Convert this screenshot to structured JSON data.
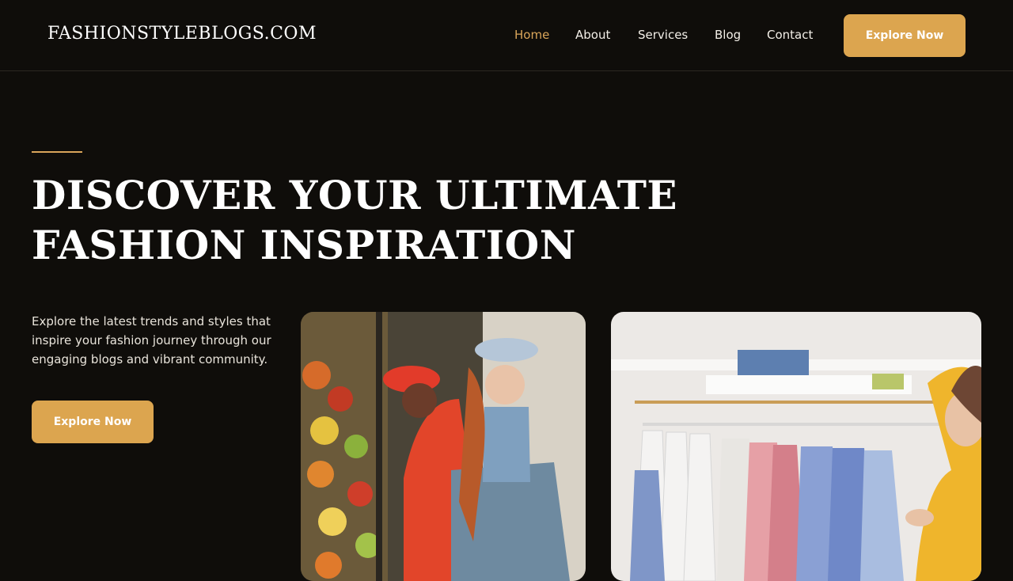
{
  "header": {
    "logo": "FASHIONSTYLEBLOGS.COM",
    "nav": [
      {
        "label": "Home",
        "active": true
      },
      {
        "label": "About",
        "active": false
      },
      {
        "label": "Services",
        "active": false
      },
      {
        "label": "Blog",
        "active": false
      },
      {
        "label": "Contact",
        "active": false
      }
    ],
    "cta_label": "Explore Now"
  },
  "hero": {
    "title": "DISCOVER YOUR ULTIMATE FASHION INSPIRATION",
    "description": "Explore the latest trends and styles that inspire your fashion journey through our engaging blogs and vibrant community.",
    "cta_label": "Explore Now"
  },
  "colors": {
    "background": "#0f0d0a",
    "accent": "#dca54f",
    "active_nav": "#d9a55a",
    "text": "#f3efe8"
  },
  "images": [
    {
      "name": "market-models-photo"
    },
    {
      "name": "clothing-rack-shopper-photo"
    }
  ]
}
